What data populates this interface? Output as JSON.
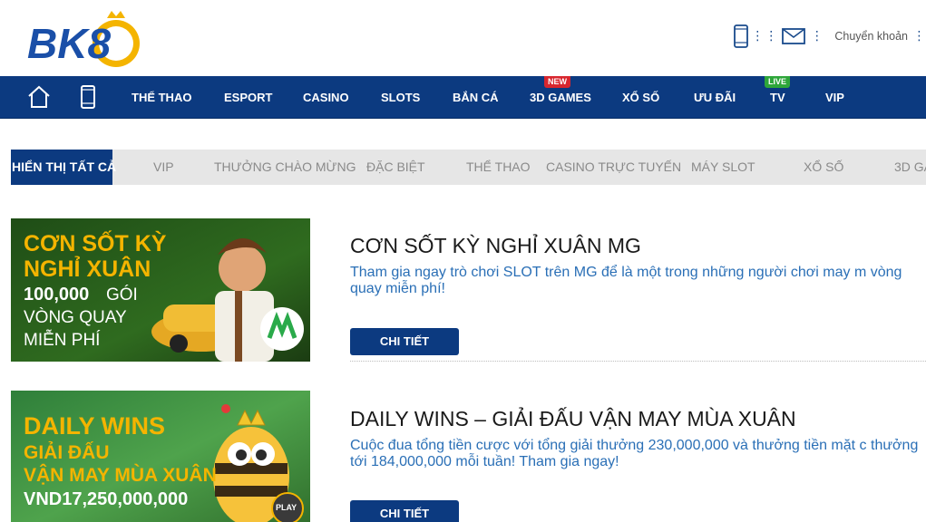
{
  "header": {
    "logo_text": "BK8",
    "transfer_label": "Chuyển khoản",
    "icons": [
      "mobile-icon",
      "mail-icon",
      "transfer-icon"
    ]
  },
  "nav": {
    "items": [
      {
        "label": "THỂ THAO"
      },
      {
        "label": "ESPORT"
      },
      {
        "label": "CASINO"
      },
      {
        "label": "SLOTS"
      },
      {
        "label": "BẮN CÁ"
      },
      {
        "label": "3D GAMES",
        "badge": "NEW"
      },
      {
        "label": "XỔ SỐ"
      },
      {
        "label": "ƯU ĐÃI"
      },
      {
        "label": "TV",
        "badge": "LIVE"
      },
      {
        "label": "VIP"
      }
    ]
  },
  "filters": {
    "items": [
      "HIỂN THỊ TẤT CẢ",
      "VIP",
      "THƯỞNG CHÀO MỪNG",
      "ĐẶC BIỆT",
      "THỂ THAO",
      "CASINO TRỰC TUYẾN",
      "MÁY SLOT",
      "XỔ SỐ",
      "3D GA"
    ],
    "active": "HIỂN THỊ TẤT CẢ"
  },
  "promos": [
    {
      "title": "CƠN SỐT KỲ NGHỈ XUÂN MG",
      "description": "Tham gia ngay trò chơi SLOT trên MG để là một trong những người chơi may m vòng quay miễn phí!",
      "button": "CHI TIẾT",
      "banner": {
        "line1": "CƠN SỐT KỲ",
        "line2": "NGHỈ XUÂN",
        "line3": "100,000",
        "line3b": "GÓI",
        "line4": "VÒNG QUAY",
        "line5": "MIỄN PHÍ"
      }
    },
    {
      "title": "DAILY WINS – GIẢI ĐẤU VẬN MAY MÙA XUÂN",
      "description": "Cuộc đua tổng tiền cược với tổng giải thưởng 230,000,000 và thưởng tiền mặt c thưởng tới 184,000,000 mỗi tuần! Tham gia ngay!",
      "button": "CHI TIẾT",
      "banner": {
        "line1": "DAILY WINS",
        "line2": "GIẢI ĐẤU",
        "line3": "VẬN MAY MÙA XUÂN",
        "line4": "VND17,250,000,000",
        "play": "PLAY"
      }
    }
  ],
  "colors": {
    "nav_bg": "#0c3a80",
    "accent_yellow": "#f4b400",
    "link_blue": "#2a6fb6"
  }
}
